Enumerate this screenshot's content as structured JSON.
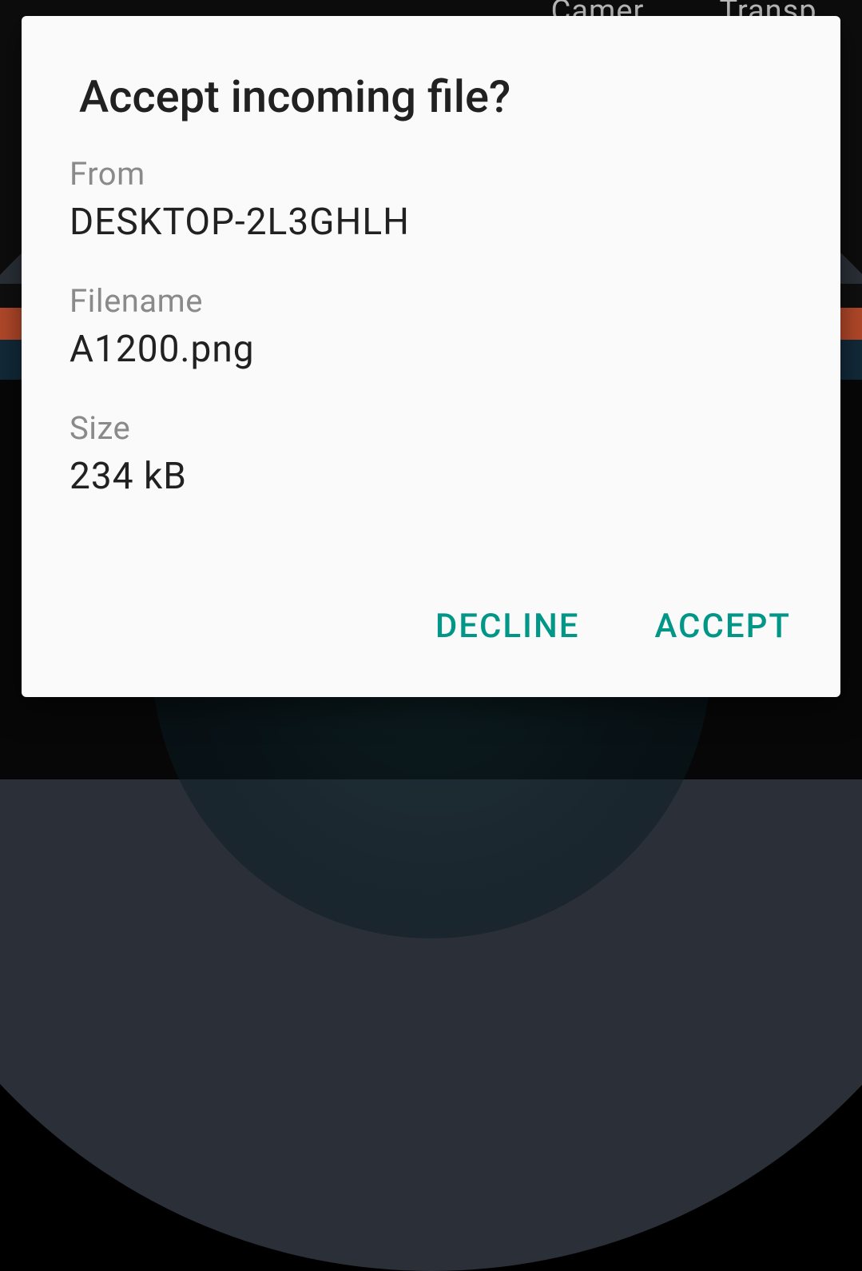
{
  "background": {
    "tab1": "Camer…",
    "tab2": "Transp…"
  },
  "dialog": {
    "title": "Accept incoming file?",
    "from_label": "From",
    "from_value": "DESKTOP-2L3GHLH",
    "filename_label": "Filename",
    "filename_value": "A1200.png",
    "size_label": "Size",
    "size_value": "234 kB",
    "decline_label": "DECLINE",
    "accept_label": "ACCEPT"
  }
}
